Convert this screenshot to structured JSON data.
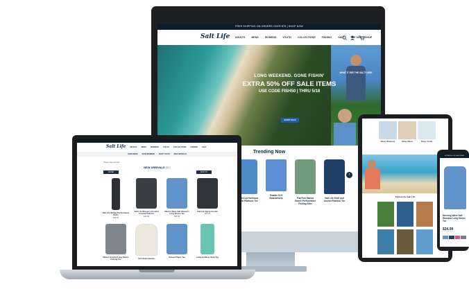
{
  "desktop": {
    "promo": "FREE SHIPPING ON ORDERS OVER $75 | SHOP NOW",
    "logo": "Salt Life",
    "nav": [
      "ADULTS",
      "MENS",
      "WOMENS",
      "YOUTH",
      "COLLECTIONS",
      "FISHING",
      "SALT",
      "THE SALTY SHOP"
    ],
    "hero": {
      "line1": "LONG WEEKEND. GONE FISHIN'",
      "line2": "EXTRA 50% OFF SALE ITEMS",
      "line3": "USE CODE FISH50 | THRU 5/18",
      "cta": "SHOP SALE",
      "side_text": "WHAT IT SEE THE SALTY SIDE"
    },
    "trending": {
      "title": "Trending Now",
      "products": [
        {
          "name": "Hooked Up Hurricane Florida Platinum Tee",
          "color": "#4d8cc9"
        },
        {
          "name": "Roadie 13.5 Boardshorts",
          "color": "#5b8dd0"
        },
        {
          "name": "Flat Fish Marina Sleeve Performance Fishing Shirt",
          "color": "#6f9a7c"
        },
        {
          "name": "Salt Life Shell and Anchor Fashion Tee",
          "color": "#1f3f66"
        }
      ]
    }
  },
  "laptop": {
    "logo": "Salt Life",
    "nav": [
      "ADULTS",
      "MENS",
      "WOMENS",
      "YOUTH",
      "COLLECTIONS",
      "FISHING",
      "SALT"
    ],
    "subnav": [
      "SHOP MENS",
      "SHOP WOMENS",
      "SHOP YOUTH",
      "NEW ARRIVALS"
    ],
    "breadcrumb": "Home / New Arrivals",
    "heading": "NEW ARRIVALS",
    "count": "(52)",
    "filter_label": "FILTER",
    "sort_label": "SORT BY",
    "products": [
      {
        "name": "Salt Life Bridge Performance Pants",
        "price": "$69.99",
        "color": "#2d2f33"
      },
      {
        "name": "Salt Life Women's Hooded Crochet Pullover",
        "price": "$49.99",
        "color": "#3a3d42"
      },
      {
        "name": "Marine Wave Salt Womens Long Sleeve Tee",
        "price": "$34.99",
        "color": "#5f93c9"
      },
      {
        "name": "Salt Life Spray Hoodie",
        "price": "$59.99",
        "color": "#2f3439"
      },
      {
        "name": "Waves Hooded Long Sleeve Fishing Tee",
        "price": "$44.99",
        "color": "#7f8690"
      },
      {
        "name": "Sun Shine Beanie",
        "price": "$24.99",
        "color": "#ece8de"
      },
      {
        "name": "Sunset Palms Tee",
        "price": "$29.99",
        "color": "#5f93c9"
      },
      {
        "name": "Lettered Racer Tank Top",
        "price": "$28.99",
        "color": "#6ac4b6"
      }
    ]
  },
  "tablet": {
    "tiles": [
      {
        "name": "Shop Womens",
        "color": "#c9d9e6"
      },
      {
        "name": "Shop Mens",
        "color": "#dfcfb9"
      },
      {
        "name": "Shop Youth",
        "color": "#d9e7ef"
      }
    ],
    "section": "Explore the Salt Life",
    "grid_colors": [
      "#4a7f3a",
      "#2f5f8f",
      "#b6794a",
      "#3d7fa8",
      "#6b5a3c",
      "#5f9ecf"
    ]
  },
  "phone": {
    "promo": "EXTRA 50% OFF SALE ITEMS",
    "product_name": "Morning Wave Salt Womens Long Sleeve Tee",
    "price": "$34.99",
    "shirt_color": "#5f93c9"
  }
}
